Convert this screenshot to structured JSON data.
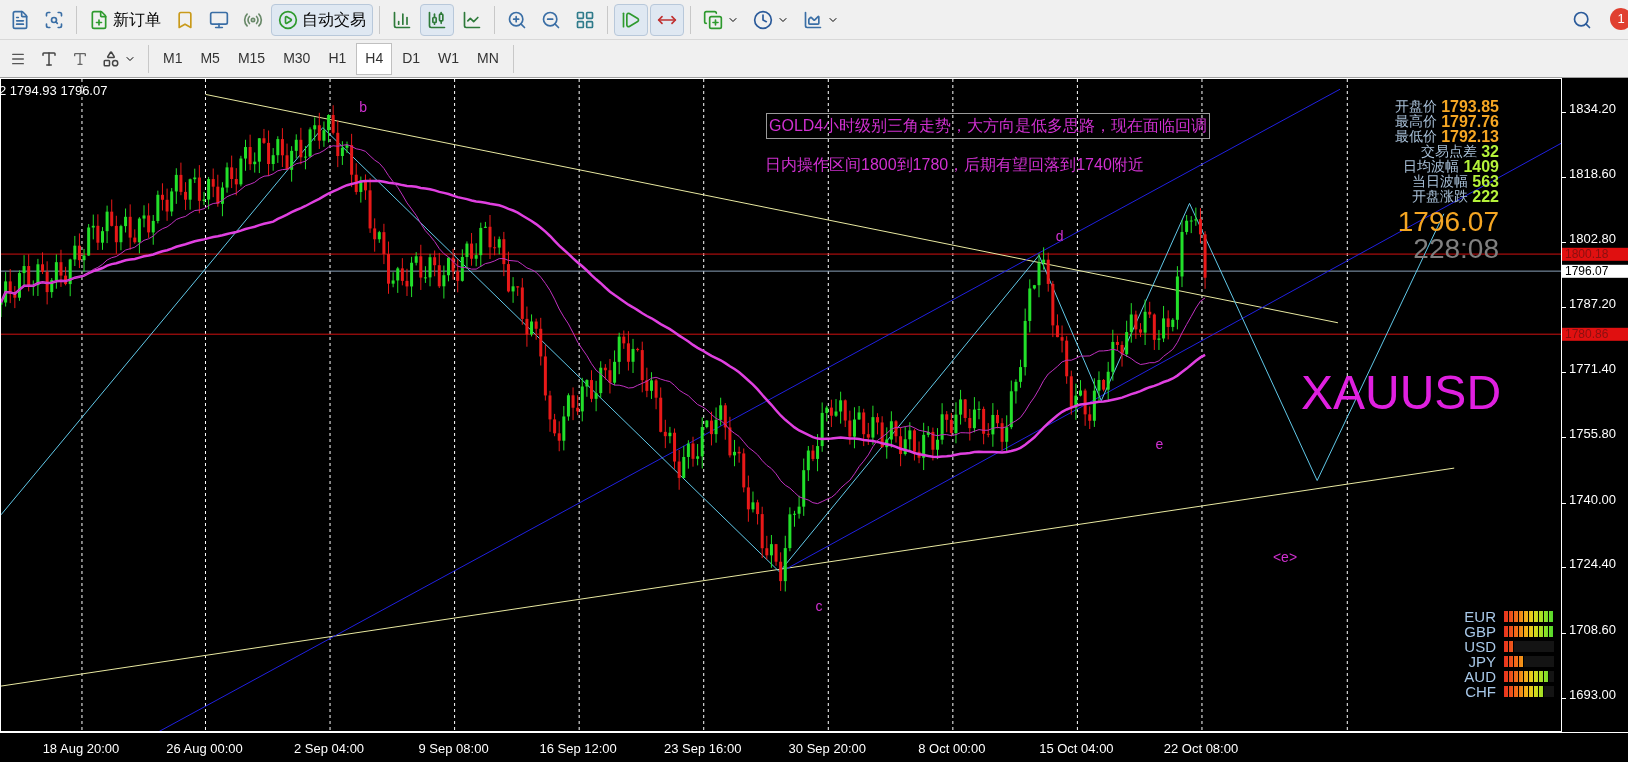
{
  "toolbar": {
    "order_button": "新订单",
    "autotrade_button": "自动交易",
    "notification_badge": "1",
    "timeframes": [
      {
        "label": "M1",
        "selected": false
      },
      {
        "label": "M5",
        "selected": false
      },
      {
        "label": "M15",
        "selected": false
      },
      {
        "label": "M30",
        "selected": false
      },
      {
        "label": "H1",
        "selected": false
      },
      {
        "label": "H4",
        "selected": true
      },
      {
        "label": "D1",
        "selected": false
      },
      {
        "label": "W1",
        "selected": false
      },
      {
        "label": "MN",
        "selected": false
      }
    ]
  },
  "chart": {
    "header": "2 1794.93 1796.07",
    "annotations": [
      "GOLD4小时级别三角走势，大方向是低多思路，现在面临回调",
      "日内操作区间1800到1780，后期有望回落到1740附近"
    ],
    "wave_labels": [
      "b",
      "c",
      "d",
      "e",
      "<e>"
    ],
    "symbol": "XAUUSD",
    "info_panel": [
      {
        "label": "开盘价",
        "value": "1793.85",
        "color": "#f5a623"
      },
      {
        "label": "最高价",
        "value": "1797.76",
        "color": "#f5a623"
      },
      {
        "label": "最低价",
        "value": "1792.13",
        "color": "#f5a623"
      },
      {
        "label": "交易点差",
        "value": "32",
        "color": "#b5f23a"
      },
      {
        "label": "日均波幅",
        "value": "1409",
        "color": "#b5f23a"
      },
      {
        "label": "当日波幅",
        "value": "563",
        "color": "#b5f23a"
      },
      {
        "label": "开盘涨跌",
        "value": "222",
        "color": "#b5f23a"
      }
    ],
    "price": "1796.07",
    "countdown": "228:08",
    "currency_strength": [
      {
        "currency": "EUR",
        "level": 1.0
      },
      {
        "currency": "GBP",
        "level": 1.0
      },
      {
        "currency": "USD",
        "level": 0.2
      },
      {
        "currency": "JPY",
        "level": 0.4
      },
      {
        "currency": "AUD",
        "level": 0.9
      },
      {
        "currency": "CHF",
        "level": 0.8
      }
    ]
  },
  "price_axis": {
    "ticks": [
      "1834.20",
      "1818.60",
      "1802.80",
      "1787.20",
      "1771.40",
      "1755.80",
      "1740.00",
      "1724.40",
      "1708.60",
      "1693.00"
    ],
    "markers": [
      {
        "label": "1800.18",
        "kind": "level"
      },
      {
        "label": "1796.07",
        "kind": "bid"
      },
      {
        "label": "1780.86",
        "kind": "level"
      }
    ]
  },
  "time_axis": [
    "18 Aug 20:00",
    "26 Aug 00:00",
    "2 Sep 04:00",
    "9 Sep 08:00",
    "16 Sep 12:00",
    "23 Sep 16:00",
    "30 Sep 20:00",
    "8 Oct 00:00",
    "15 Oct 04:00",
    "22 Oct 08:00"
  ]
}
